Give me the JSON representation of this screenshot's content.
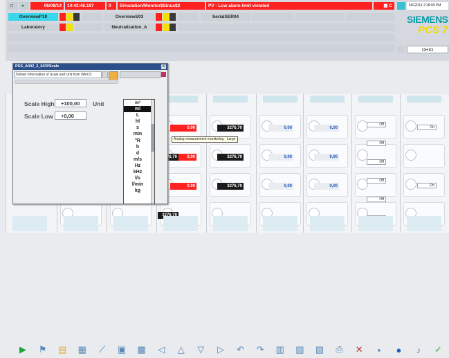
{
  "header": {
    "date": "06/08/14",
    "time": "14:42:46.197",
    "counter": "0",
    "alarm_path": "Simulation/Monitor$Sinus$2",
    "alarm_text": "PV - Low alarm limit violated",
    "alarm_class": "C",
    "clock": "6/6/2014 2:28:09 PM",
    "brand": "SIEMENS",
    "product": "PCS 7",
    "area_buttons": [
      "OverviewP10",
      "Laboratory"
    ],
    "area_buttons_2": [
      "OverviewS03",
      "Neutralization_A"
    ],
    "area_button_3": "SerialSER04",
    "server": "OHIO"
  },
  "dialog": {
    "title": "PSS_A002_2_0/OPScale",
    "description": "Deliver Information of Scale and Unit from WinCC",
    "close": "x",
    "scale_high_label": "Scale High",
    "scale_high_value": "+100,00",
    "scale_low_label": "Scale Low",
    "scale_low_value": "+0,00",
    "unit_label": "Unit",
    "unit_selected": "m²",
    "unit_options": [
      "ml",
      "L",
      "hl",
      "s",
      "min",
      "°R",
      "h",
      "d",
      "m/s",
      "Hz",
      "kHz",
      "l/s",
      "l/min",
      "kg"
    ]
  },
  "tooltip": "Analog measurement monitoring - Large",
  "plant": {
    "values_red": [
      "0,00",
      "0,00",
      "0,00"
    ],
    "values_dark": [
      "3276,70",
      "3276,70",
      "3276,70",
      "3276,70",
      "3276,70"
    ],
    "values_blue": [
      "0,00",
      "0,00",
      "0,00",
      "0,00",
      "0,00",
      "0,00"
    ],
    "off_label": "Off",
    "on_label": "On"
  },
  "toolbar": {
    "icons": [
      "run-icon",
      "filter-icon",
      "folder-icon",
      "report-icon",
      "trend-icon",
      "picture-tree-icon",
      "picture-icon",
      "nav-first-icon",
      "nav-up-icon",
      "nav-down-icon",
      "nav-next-icon",
      "back-icon",
      "forward-icon",
      "overview-icon",
      "area-icon",
      "save-icon",
      "print-icon",
      "delete-icon",
      "lock-icon",
      "user-icon",
      "sound-icon",
      "ack-icon"
    ]
  },
  "colors": {
    "alarm_red": "#ff2020",
    "warn_yellow": "#f4e100",
    "dialog_title": "#2b4f8a",
    "brand_teal": "#0a9aa6",
    "brand_yellow": "#f4d800"
  }
}
